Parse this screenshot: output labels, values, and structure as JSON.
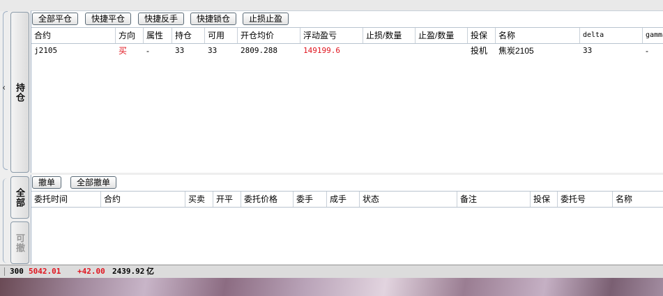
{
  "positions_tab": "持仓",
  "orders_tabs": {
    "all": "全部",
    "cancellable": "可撤"
  },
  "position_toolbar": {
    "buttons": [
      "全部平仓",
      "快捷平仓",
      "快捷反手",
      "快捷锁仓",
      "止损止盈"
    ]
  },
  "position_table": {
    "headers": [
      "合约",
      "方向",
      "属性",
      "持仓",
      "可用",
      "开仓均价",
      "浮动盈亏",
      "止损/数量",
      "止盈/数量",
      "投保",
      "名称",
      "delta",
      "gamma"
    ],
    "rows": [
      {
        "contract": "j2105",
        "direction": "买",
        "attribute": "-",
        "position": "33",
        "available": "33",
        "open_avg_price": "2809.288",
        "floating_pnl": "149199.6",
        "stop_loss": "",
        "take_profit": "",
        "hedge": "投机",
        "name": "焦炭2105",
        "delta": "33",
        "gamma": "-"
      }
    ]
  },
  "order_toolbar": {
    "cancel": "撤单",
    "cancel_all": "全部撤单"
  },
  "order_table": {
    "headers": [
      "委托时间",
      "合约",
      "买卖",
      "开平",
      "委托价格",
      "委手",
      "成手",
      "状态",
      "备注",
      "投保",
      "委托号",
      "名称"
    ]
  },
  "status_bar": {
    "code": "300",
    "price": "5042.01",
    "change": "+42.00",
    "volume": "2439.92",
    "volume_unit": "亿"
  },
  "colors": {
    "down_red": "#e0141e",
    "border": "#9fb0c4",
    "status_bg": "#dcdcdc"
  }
}
